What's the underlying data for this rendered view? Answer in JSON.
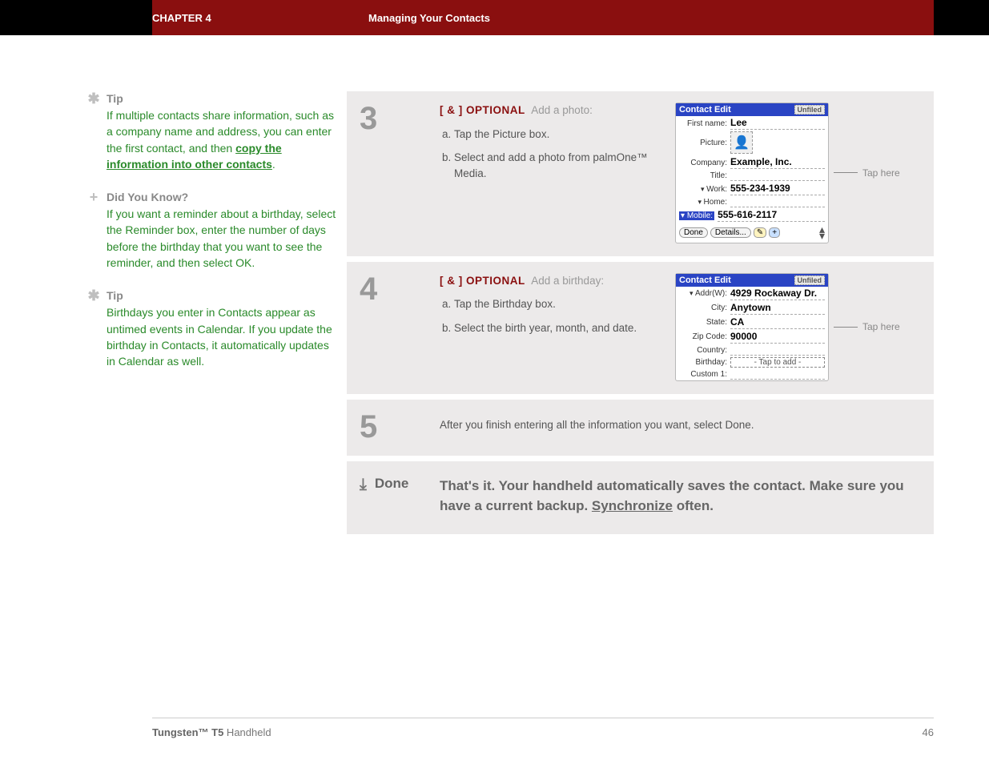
{
  "header": {
    "chapter": "CHAPTER 4",
    "title": "Managing Your Contacts"
  },
  "sidebar": {
    "tip1": {
      "label": "Tip",
      "text_a": "If multiple contacts share information, such as a company name and address, you can enter the first contact, and then ",
      "link": "copy the information into other contacts",
      "text_b": "."
    },
    "dyk": {
      "label": "Did You Know?",
      "body": "If you want a reminder about a birthday, select the Reminder box, enter the number of days before the birthday that you want to see the reminder, and then select OK."
    },
    "tip2": {
      "label": "Tip",
      "body": "Birthdays you enter in Contacts appear as untimed events in Calendar. If you update the birthday in Contacts, it automatically updates in Calendar as well."
    }
  },
  "steps": {
    "s3": {
      "num": "3",
      "tag": "[ & ]  OPTIONAL",
      "lead": "Add a photo:",
      "a": "Tap the Picture box.",
      "b": "Select and add a photo from palmOne™ Media.",
      "callout": "Tap here",
      "pda": {
        "title": "Contact Edit",
        "cat": "Unfiled",
        "fields": {
          "firstname_l": "First name:",
          "firstname_v": "Lee",
          "picture_l": "Picture:",
          "company_l": "Company:",
          "company_v": "Example, Inc.",
          "title_l": "Title:",
          "work_l": "Work:",
          "work_v": "555-234-1939",
          "home_l": "Home:",
          "mobile_l": "Mobile:",
          "mobile_v": "555-616-2117"
        },
        "btn_done": "Done",
        "btn_details": "Details...",
        "btn_note": "✎",
        "btn_plus": "+"
      }
    },
    "s4": {
      "num": "4",
      "tag": "[ & ]  OPTIONAL",
      "lead": "Add a birthday:",
      "a": "Tap the Birthday box.",
      "b": "Select the birth year, month, and date.",
      "callout": "Tap here",
      "pda": {
        "title": "Contact Edit",
        "cat": "Unfiled",
        "fields": {
          "addr_l": "Addr(W):",
          "addr_v": "4929 Rockaway Dr.",
          "city_l": "City:",
          "city_v": "Anytown",
          "state_l": "State:",
          "state_v": "CA",
          "zip_l": "Zip Code:",
          "zip_v": "90000",
          "country_l": "Country:",
          "birthday_l": "Birthday:",
          "birthday_v": "- Tap to add -",
          "custom1_l": "Custom 1:"
        }
      }
    },
    "s5": {
      "num": "5",
      "body": "After you finish entering all the information you want, select Done."
    },
    "done": {
      "label": "Done",
      "text_a": "That's it. Your handheld automatically saves the contact. Make sure you have a current backup. ",
      "link": "Synchronize",
      "text_b": " often."
    }
  },
  "footer": {
    "product_bold": "Tungsten™ T5",
    "product_rest": " Handheld",
    "page": "46"
  }
}
